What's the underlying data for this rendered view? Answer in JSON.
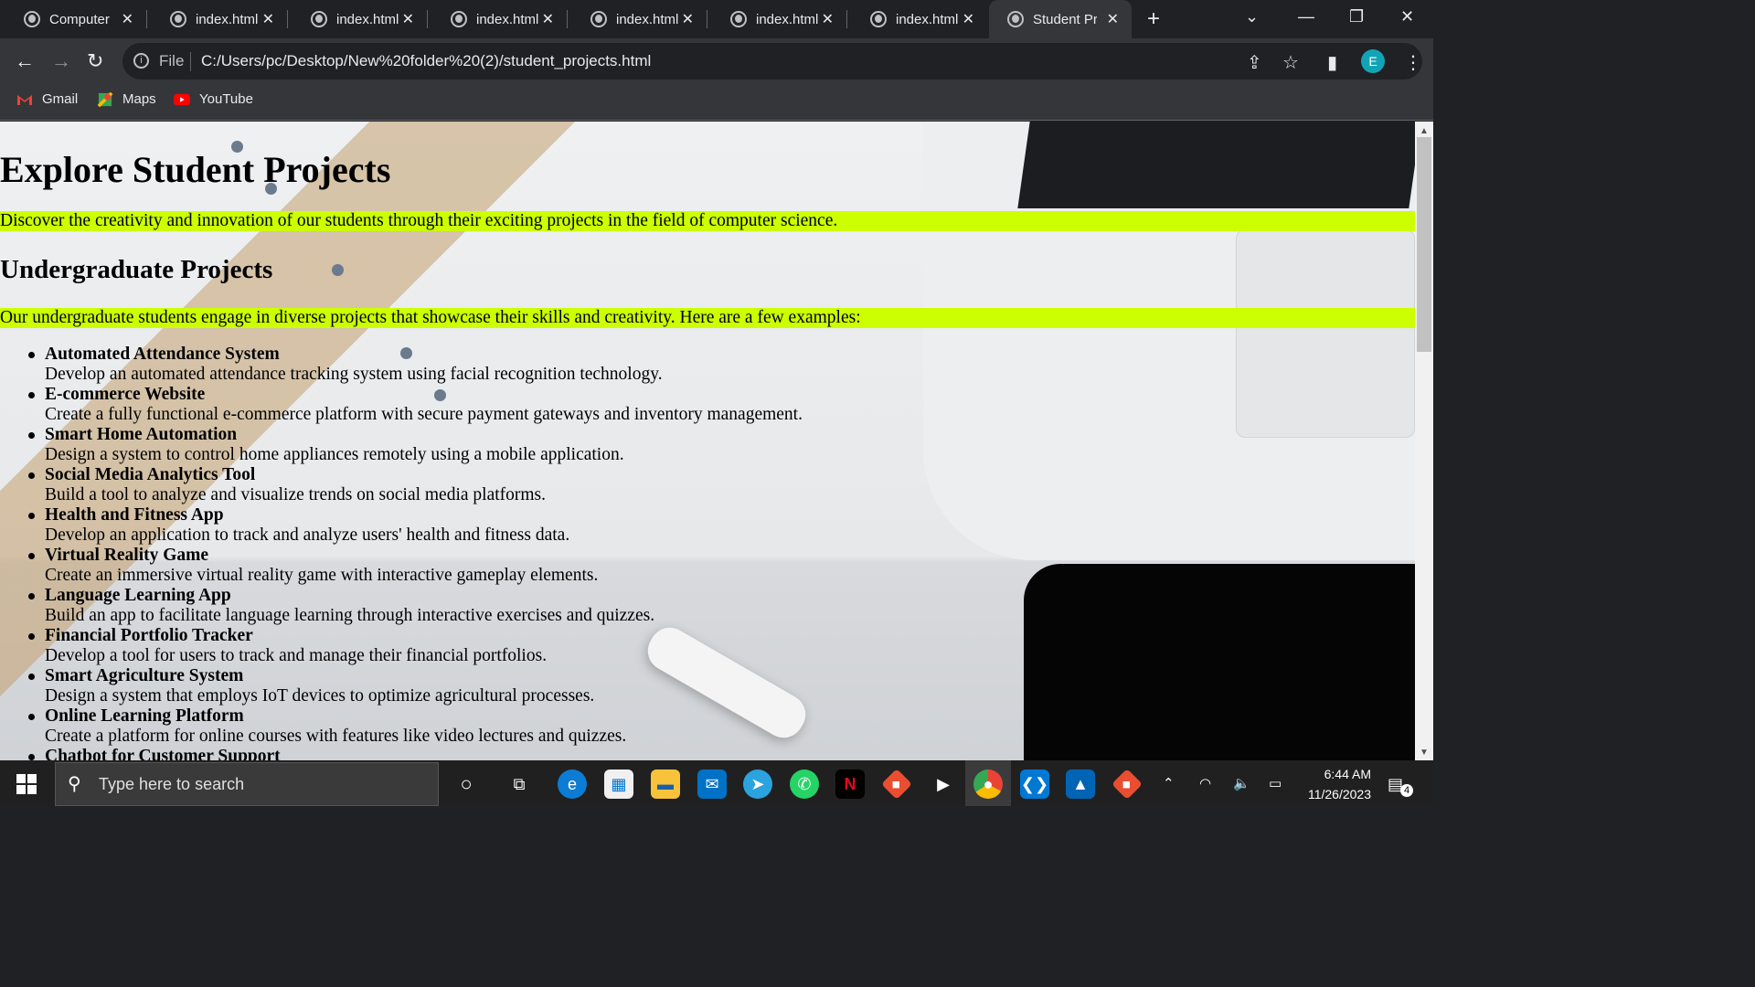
{
  "browser": {
    "tabs": [
      {
        "title": "Computer",
        "active": false
      },
      {
        "title": "index.html",
        "active": false
      },
      {
        "title": "index.html",
        "active": false
      },
      {
        "title": "index.html",
        "active": false
      },
      {
        "title": "index.html",
        "active": false
      },
      {
        "title": "index.html",
        "active": false
      },
      {
        "title": "index.html",
        "active": false
      },
      {
        "title": "Student Pr",
        "active": true
      }
    ],
    "new_tab": "+",
    "url_scheme_label": "File",
    "url": "C:/Users/pc/Desktop/New%20folder%20(2)/student_projects.html",
    "profile_initial": "E",
    "bookmarks": [
      {
        "label": "Gmail",
        "icon": "gmail-icon"
      },
      {
        "label": "Maps",
        "icon": "maps-icon"
      },
      {
        "label": "YouTube",
        "icon": "youtube-icon"
      }
    ]
  },
  "page": {
    "title": "Explore Student Projects",
    "intro": "Discover the creativity and innovation of our students through their exciting projects in the field of computer science.",
    "section_title": "Undergraduate Projects",
    "section_intro": "Our undergraduate students engage in diverse projects that showcase their skills and creativity. Here are a few examples:",
    "projects": [
      {
        "name": "Automated Attendance System",
        "desc": "Develop an automated attendance tracking system using facial recognition technology."
      },
      {
        "name": "E-commerce Website",
        "desc": "Create a fully functional e-commerce platform with secure payment gateways and inventory management."
      },
      {
        "name": "Smart Home Automation",
        "desc": "Design a system to control home appliances remotely using a mobile application."
      },
      {
        "name": "Social Media Analytics Tool",
        "desc": "Build a tool to analyze and visualize trends on social media platforms."
      },
      {
        "name": "Health and Fitness App",
        "desc": "Develop an application to track and analyze users' health and fitness data."
      },
      {
        "name": "Virtual Reality Game",
        "desc": "Create an immersive virtual reality game with interactive gameplay elements."
      },
      {
        "name": "Language Learning App",
        "desc": "Build an app to facilitate language learning through interactive exercises and quizzes."
      },
      {
        "name": "Financial Portfolio Tracker",
        "desc": "Develop a tool for users to track and manage their financial portfolios."
      },
      {
        "name": "Smart Agriculture System",
        "desc": "Design a system that employs IoT devices to optimize agricultural processes."
      },
      {
        "name": "Online Learning Platform",
        "desc": "Create a platform for online courses with features like video lectures and quizzes."
      },
      {
        "name": "Chatbot for Customer Support",
        "desc": ""
      }
    ],
    "highlight_color": "#ccff00"
  },
  "taskbar": {
    "search_placeholder": "Type here to search",
    "time": "6:44 AM",
    "date": "11/26/2023",
    "notification_count": "4",
    "apps": [
      "cortana-icon",
      "task-view-icon",
      "edge-icon",
      "store-icon",
      "file-explorer-icon",
      "mail-icon",
      "telegram-icon",
      "whatsapp-icon",
      "netflix-icon",
      "git-icon",
      "media-player-icon",
      "chrome-icon",
      "vscode-icon",
      "photos-icon",
      "git-icon"
    ]
  }
}
